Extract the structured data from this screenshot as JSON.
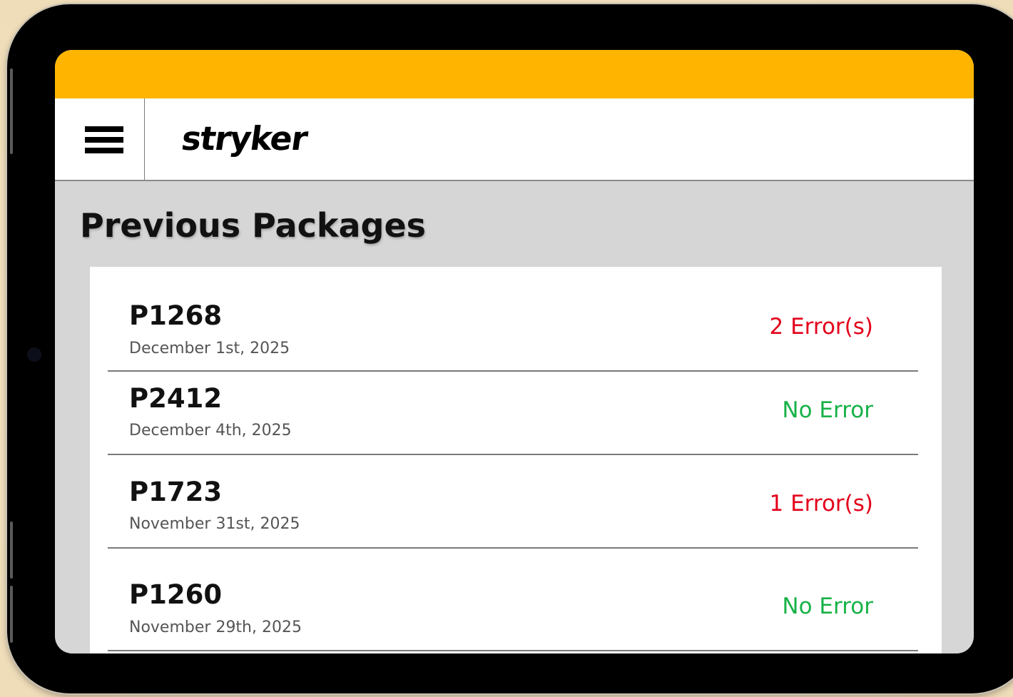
{
  "header": {
    "menu_icon": "hamburger-menu-icon",
    "logo_text": "stryker",
    "accent_color": "#ffb500"
  },
  "page": {
    "title": "Previous Packages"
  },
  "packages": [
    {
      "id": "P1268",
      "date": "December 1st, 2025",
      "status": "2 Error(s)",
      "status_type": "error"
    },
    {
      "id": "P2412",
      "date": "December 4th, 2025",
      "status": "No Error",
      "status_type": "ok"
    },
    {
      "id": "P1723",
      "date": "November 31st, 2025",
      "status": "1 Error(s)",
      "status_type": "error"
    },
    {
      "id": "P1260",
      "date": "November 29th, 2025",
      "status": "No Error",
      "status_type": "ok"
    }
  ],
  "colors": {
    "error": "#e3001b",
    "ok": "#17b247"
  }
}
